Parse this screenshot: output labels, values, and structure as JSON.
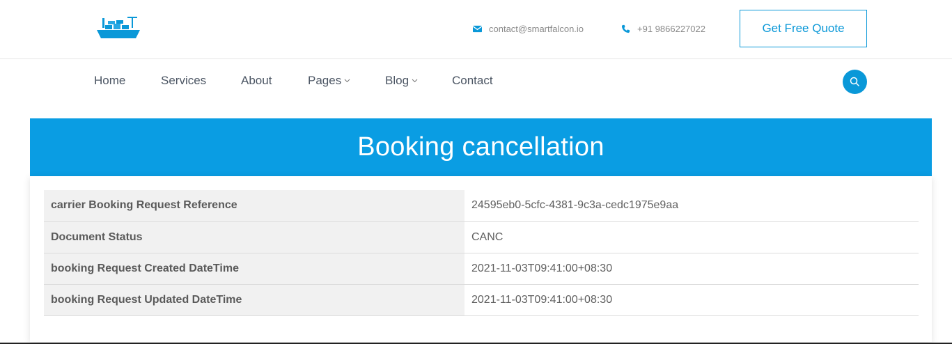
{
  "header": {
    "email": "contact@smartfalcon.io",
    "phone": "+91 9866227022",
    "quote_button": "Get Free Quote",
    "logo_icon": "cargo-ship-icon",
    "accent_color": "#0a98d8"
  },
  "nav": {
    "items": [
      {
        "label": "Home"
      },
      {
        "label": "Services"
      },
      {
        "label": "About"
      },
      {
        "label": "Pages"
      },
      {
        "label": "Blog"
      },
      {
        "label": "Contact"
      }
    ],
    "search_icon": "search-icon"
  },
  "page": {
    "title": "Booking cancellation",
    "banner_color": "#0a9de3"
  },
  "details": {
    "rows": [
      {
        "key": "carrier Booking Request Reference",
        "value": "24595eb0-5cfc-4381-9c3a-cedc1975e9aa"
      },
      {
        "key": "Document Status",
        "value": "CANC"
      },
      {
        "key": "booking Request Created DateTime",
        "value": "2021-11-03T09:41:00+08:30"
      },
      {
        "key": "booking Request Updated DateTime",
        "value": "2021-11-03T09:41:00+08:30"
      }
    ]
  }
}
